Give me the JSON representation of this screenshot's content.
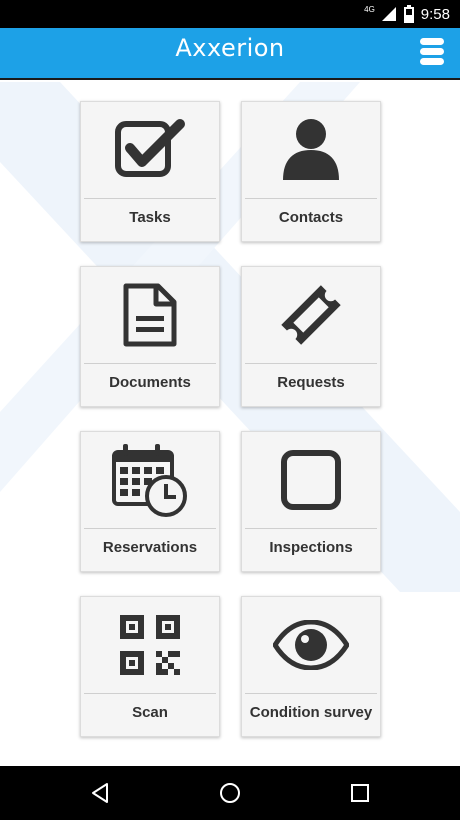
{
  "status_bar": {
    "network": "4G",
    "time": "9:58",
    "icons": [
      "signal-icon",
      "battery-icon"
    ]
  },
  "app_bar": {
    "title": "Axxerion",
    "menu_icon": "hamburger-menu-icon",
    "color": "#1da1e7"
  },
  "tiles": [
    {
      "label": "Tasks",
      "icon": "checkbox-checked-icon"
    },
    {
      "label": "Contacts",
      "icon": "person-icon"
    },
    {
      "label": "Documents",
      "icon": "document-icon"
    },
    {
      "label": "Requests",
      "icon": "ticket-icon"
    },
    {
      "label": "Reservations",
      "icon": "calendar-clock-icon"
    },
    {
      "label": "Inspections",
      "icon": "checkbox-empty-icon"
    },
    {
      "label": "Scan",
      "icon": "qr-code-icon"
    },
    {
      "label": "Condition survey",
      "icon": "eye-icon"
    }
  ],
  "nav_bar": {
    "buttons": [
      "back-icon",
      "home-icon",
      "recents-icon"
    ]
  }
}
